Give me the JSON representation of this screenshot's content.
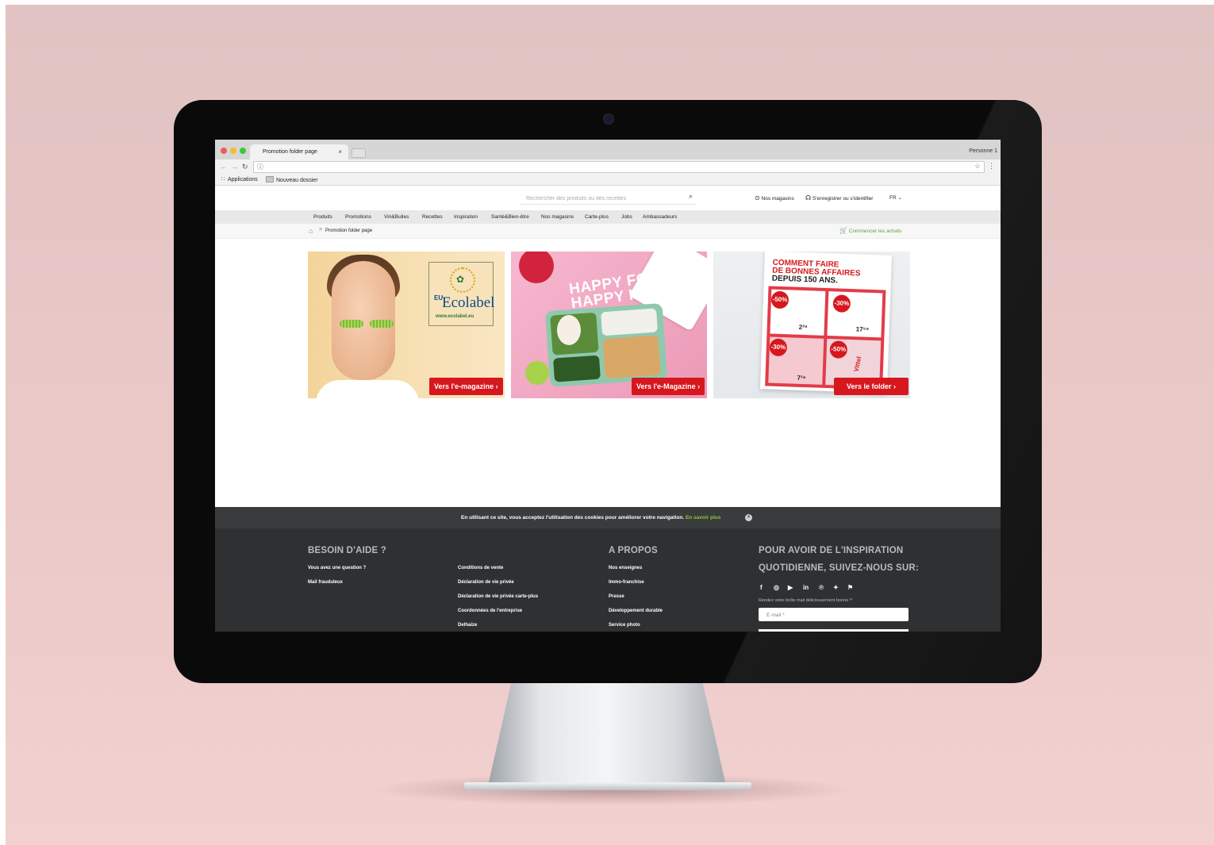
{
  "browser": {
    "tab_title": "Promotion folder page",
    "tab_close": "×",
    "profile": "Personne 1",
    "bookmarks": [
      "Applications",
      "Nouveau dossier"
    ],
    "traffic_colors": [
      "#ee5e56",
      "#f5bd2f",
      "#3ec840"
    ]
  },
  "header": {
    "search_placeholder": "Rechercher des produits ou des recettes",
    "stores": "Nos magasins",
    "account": "S'enregistrer ou s'identifier",
    "lang": "FR"
  },
  "nav": [
    "Produits",
    "Promotions",
    "Vin&Bulles",
    "Recettes",
    "Inspiration",
    "Santé&Bien-être",
    "Nos magasins",
    "Carte-plus",
    "Jobs",
    "Ambassadeurs"
  ],
  "breadcrumb": {
    "current": "Promotion folder page",
    "sep": ">",
    "shop": "Commencer les achats"
  },
  "cards": [
    {
      "cta": "Vers l'e-magazine ›",
      "ecolabel": {
        "eu": "EU",
        "name": "Ecolabel",
        "url": "www.ecolabel.eu"
      }
    },
    {
      "cta": "Vers l'e-Magazine ›",
      "headline_1": "HAPPY FOOD,",
      "headline_2": "HAPPY KIDS"
    },
    {
      "cta": "Vers le folder ›",
      "folder": {
        "title_1": "COMMENT FAIRE",
        "title_2": "DE BONNES AFFAIRES",
        "title_3": "DEPUIS 150 ANS.",
        "pcts": [
          "-50%",
          "-30%",
          "-30%",
          "-50%"
        ],
        "prices": [
          "2²⁹",
          "17⁵⁹",
          "7¹⁹"
        ],
        "product": "Vittel"
      }
    }
  ],
  "cookie": {
    "message": "En utilisant ce site, vous acceptez l'utilisation des cookies pour améliorer votre navigation.",
    "link": "En savoir plus",
    "close": "×"
  },
  "footer": {
    "help_title": "BESOIN D'AIDE ?",
    "help_links": [
      "Vous avez une question ?",
      "Mail frauduleux"
    ],
    "legal_links": [
      "Conditions de vente",
      "Déclaration de vie privée",
      "Déclaration de vie privée carte-plus",
      "Coordonnées de l'entreprise",
      "Delhaize"
    ],
    "about_title": "A PROPOS",
    "about_links": [
      "Nos enseignes",
      "Immo-franchise",
      "Presse",
      "Développement durable",
      "Service photo"
    ],
    "social_title_1": "POUR AVOIR DE L'INSPIRATION",
    "social_title_2": "QUOTIDIENNE, SUIVEZ-NOUS SUR:",
    "social_icons": [
      "facebook-icon",
      "instagram-icon",
      "youtube-icon",
      "linkedin-icon",
      "pinterest-icon",
      "twitter-icon",
      "foursquare-icon"
    ],
    "newsletter_label": "Rendez votre boîte mail délicieusement bonne !*",
    "email_placeholder": "E-mail *"
  }
}
